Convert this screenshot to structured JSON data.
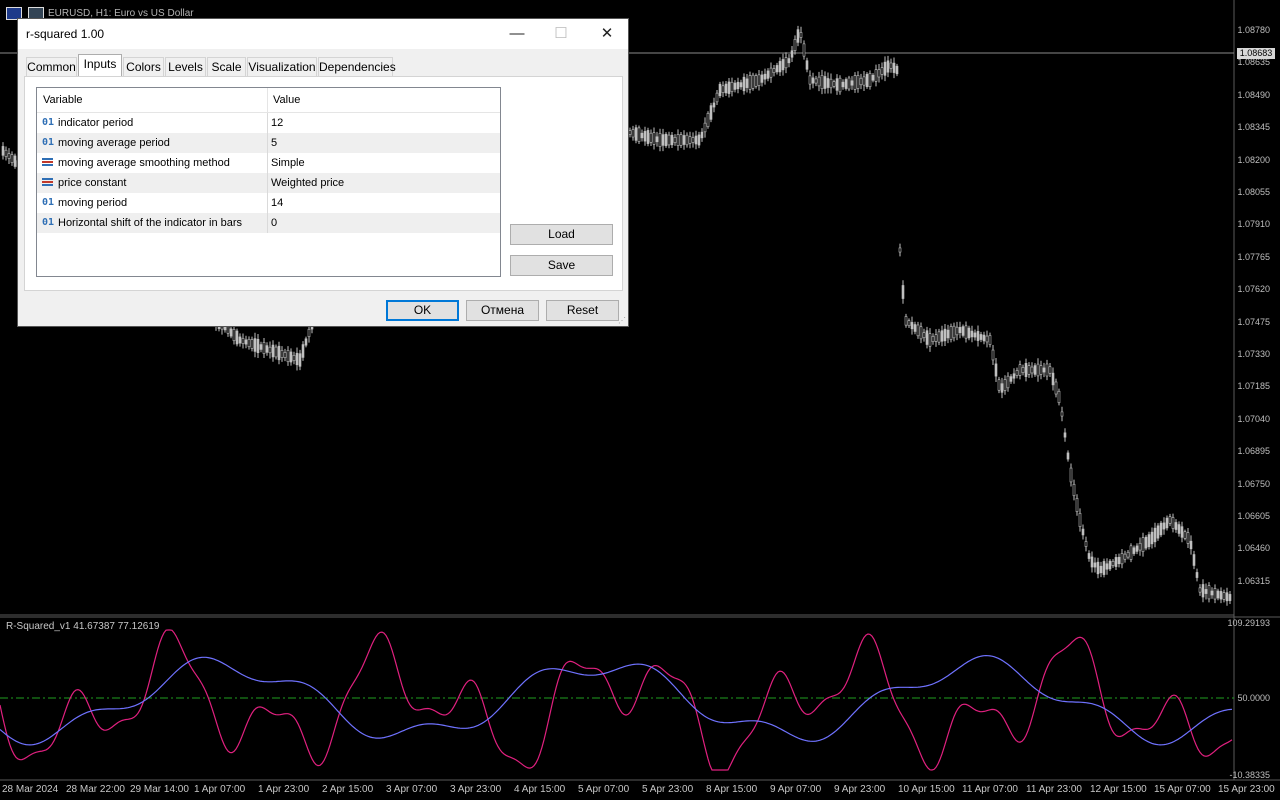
{
  "window": {
    "title": "EURUSD, H1:  Euro vs US Dollar"
  },
  "price_axis": {
    "labels": [
      "1.08780",
      "1.08635",
      "1.08490",
      "1.08345",
      "1.08200",
      "1.08055",
      "1.07910",
      "1.07765",
      "1.07620",
      "1.07475",
      "1.07330",
      "1.07185",
      "1.07040",
      "1.06895",
      "1.06750",
      "1.06605",
      "1.06460",
      "1.06315"
    ],
    "current_price": "1.08683"
  },
  "indicator": {
    "label": "R-Squared_v1 41.67387 77.12619",
    "axis_labels": [
      "109.29193",
      "50.0000",
      "-10.38335"
    ]
  },
  "time_axis": {
    "labels": [
      "28 Mar 2024",
      "28 Mar 22:00",
      "29 Mar 14:00",
      "1 Apr 07:00",
      "1 Apr 23:00",
      "2 Apr 15:00",
      "3 Apr 07:00",
      "3 Apr 23:00",
      "4 Apr 15:00",
      "5 Apr 07:00",
      "5 Apr 23:00",
      "8 Apr 15:00",
      "9 Apr 07:00",
      "9 Apr 23:00",
      "10 Apr 15:00",
      "11 Apr 07:00",
      "11 Apr 23:00",
      "12 Apr 15:00",
      "15 Apr 07:00",
      "15 Apr 23:00"
    ]
  },
  "colors": {
    "background": "#000000",
    "candles": "#c0c0c0",
    "r_squared_line": "#e0207f",
    "ma_line": "#6f72ff",
    "level_line": "#1f9e1f",
    "grid_border": "#828790",
    "default_button_border": "#0078d7"
  },
  "dialog": {
    "title": "r-squared 1.00",
    "controls": {
      "minimize": "—",
      "maximize": "☐",
      "close": "✕"
    },
    "tabs": [
      "Common",
      "Inputs",
      "Colors",
      "Levels",
      "Scale",
      "Visualization",
      "Dependencies"
    ],
    "active_tab": "Inputs",
    "grid": {
      "col_variable": "Variable",
      "col_value": "Value",
      "rows": [
        {
          "icon": "01",
          "name": "indicator period",
          "value": "12"
        },
        {
          "icon": "list-icon",
          "name": "moving average period",
          "value": "5"
        },
        {
          "icon": "list-icon",
          "name": "moving average smoothing method",
          "value": "Simple"
        },
        {
          "icon": "list-icon",
          "name": "price constant",
          "value": "Weighted price"
        },
        {
          "icon": "01",
          "name": "moving period",
          "value": "14"
        },
        {
          "icon": "01",
          "name": "Horizontal shift of the indicator in bars",
          "value": "0"
        }
      ]
    },
    "buttons": {
      "load": "Load",
      "save": "Save",
      "ok": "OK",
      "cancel": "Отмена",
      "reset": "Reset"
    }
  }
}
